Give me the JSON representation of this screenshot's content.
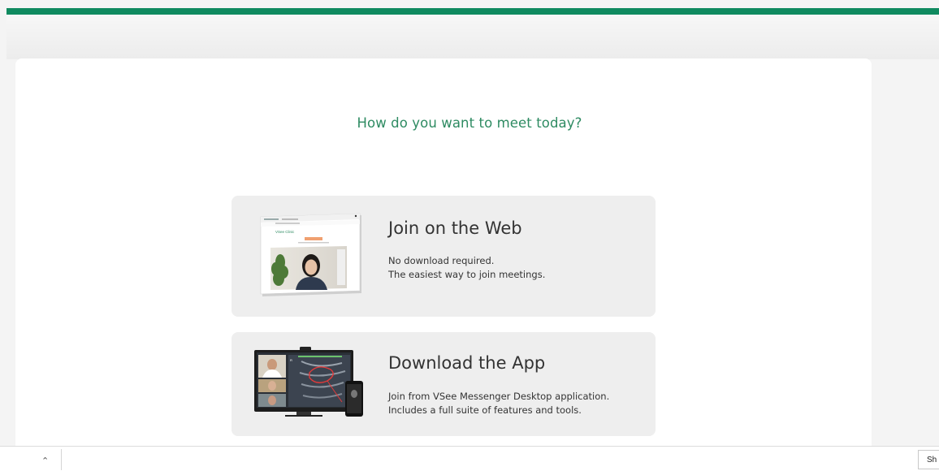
{
  "page": {
    "heading": "How do you want to meet today?"
  },
  "options": [
    {
      "title": "Join on the Web",
      "desc_line1": "No download required.",
      "desc_line2": "The easiest way to join meetings.",
      "image": "web-browser-video-call-illustration"
    },
    {
      "title": "Download the App",
      "desc_line1": "Join from VSee Messenger Desktop application.",
      "desc_line2": "Includes a full suite of features and tools.",
      "image": "desktop-app-telehealth-illustration"
    }
  ],
  "web_thumb": {
    "brand": "VSee Clinic"
  },
  "bottom_bar": {
    "chevron_icon": "chevron-up-icon",
    "show_label": "Sh"
  },
  "colors": {
    "accent": "#0f8a5f",
    "heading": "#2e8b62",
    "option_bg": "#eeeeee"
  }
}
